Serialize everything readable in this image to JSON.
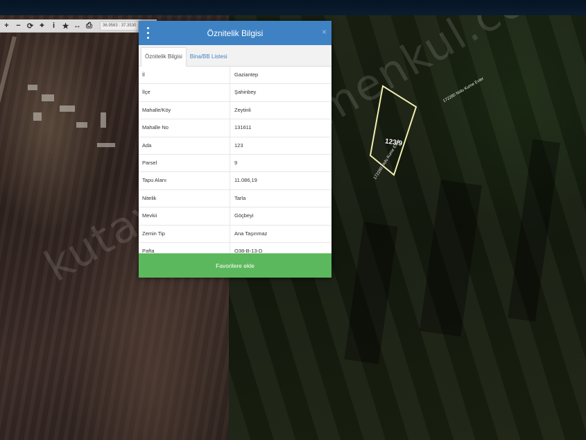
{
  "toolbar": {
    "buttons": [
      {
        "name": "zoom-in",
        "glyph": "+"
      },
      {
        "name": "zoom-out",
        "glyph": "−"
      },
      {
        "name": "refresh",
        "glyph": "⟳"
      },
      {
        "name": "locate",
        "glyph": "⌖"
      },
      {
        "name": "info",
        "glyph": "i"
      },
      {
        "name": "favorite",
        "glyph": "★"
      },
      {
        "name": "measure",
        "glyph": "↔"
      },
      {
        "name": "print",
        "glyph": "⎙"
      }
    ],
    "coordinates": "36.9563 : 37.3530"
  },
  "map": {
    "parcel_label": "123/9",
    "road_label_a": "172280 Nolu Kume Evler",
    "road_label_b": "172280 Nolu Kume Evler",
    "watermark": "kutayalpgayrimenkul.com.tr"
  },
  "dialog": {
    "title": "Öznitelik Bilgisi",
    "close_glyph": "×",
    "tabs": [
      {
        "label": "Öznitelik Bilgisi",
        "active": true
      },
      {
        "label": "Bina/BB Listesi",
        "active": false
      }
    ],
    "rows": [
      {
        "key": "İl",
        "value": "Gaziantep"
      },
      {
        "key": "İlçe",
        "value": "Şahinbey"
      },
      {
        "key": "Mahalle/Köy",
        "value": "Zeytinli"
      },
      {
        "key": "Mahalle No",
        "value": "131611"
      },
      {
        "key": "Ada",
        "value": "123"
      },
      {
        "key": "Parsel",
        "value": "9"
      },
      {
        "key": "Tapu Alanı",
        "value": "11.086,19"
      },
      {
        "key": "Nitelik",
        "value": "Tarla"
      },
      {
        "key": "Mevkii",
        "value": "Göçbeyi"
      },
      {
        "key": "Zemin Tip",
        "value": "Ana Taşınmaz"
      },
      {
        "key": "Pafta",
        "value": "O38-B-13-D"
      }
    ],
    "favorite_button": "Favorilere ekle"
  },
  "colors": {
    "header_blue": "#3f82c4",
    "favorite_green": "#5cb85c",
    "parcel_outline": "#f2efb0"
  }
}
